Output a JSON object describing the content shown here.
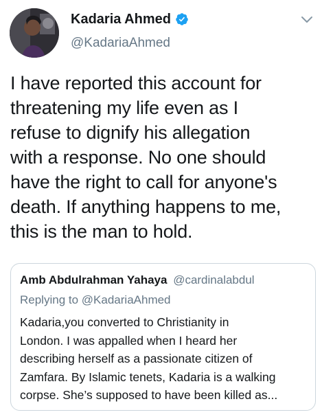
{
  "author": {
    "display_name": "Kadaria Ahmed",
    "handle": "@KadariaAhmed",
    "verified": true,
    "verified_icon": "verified-badge-icon",
    "avatar_icon": "profile-photo"
  },
  "menu": {
    "icon": "chevron-down-icon"
  },
  "tweet": {
    "text": "I have reported this account for\nthreatening my life even as I\nrefuse to dignify his allegation\nwith a response.  No one should\nhave the right to call for anyone's\ndeath. If anything happens to me,\nthis is the man to hold."
  },
  "quoted": {
    "display_name": "Amb Abdulrahman Yahaya",
    "handle": "@cardinalabdul",
    "replying_prefix": "Replying to",
    "replying_to": "@KadariaAhmed",
    "text": "Kadaria,you  converted to Christianity in\nLondon. I was appalled when I heard her\ndescribing herself as a passionate citizen of\nZamfara. By Islamic tenets, Kadaria is a walking\ncorpse. She’s supposed to have been killed as..."
  },
  "colors": {
    "primary_text": "#14171a",
    "secondary_text": "#657786",
    "verified_blue": "#1da1f2",
    "border": "#ccd6dd"
  }
}
